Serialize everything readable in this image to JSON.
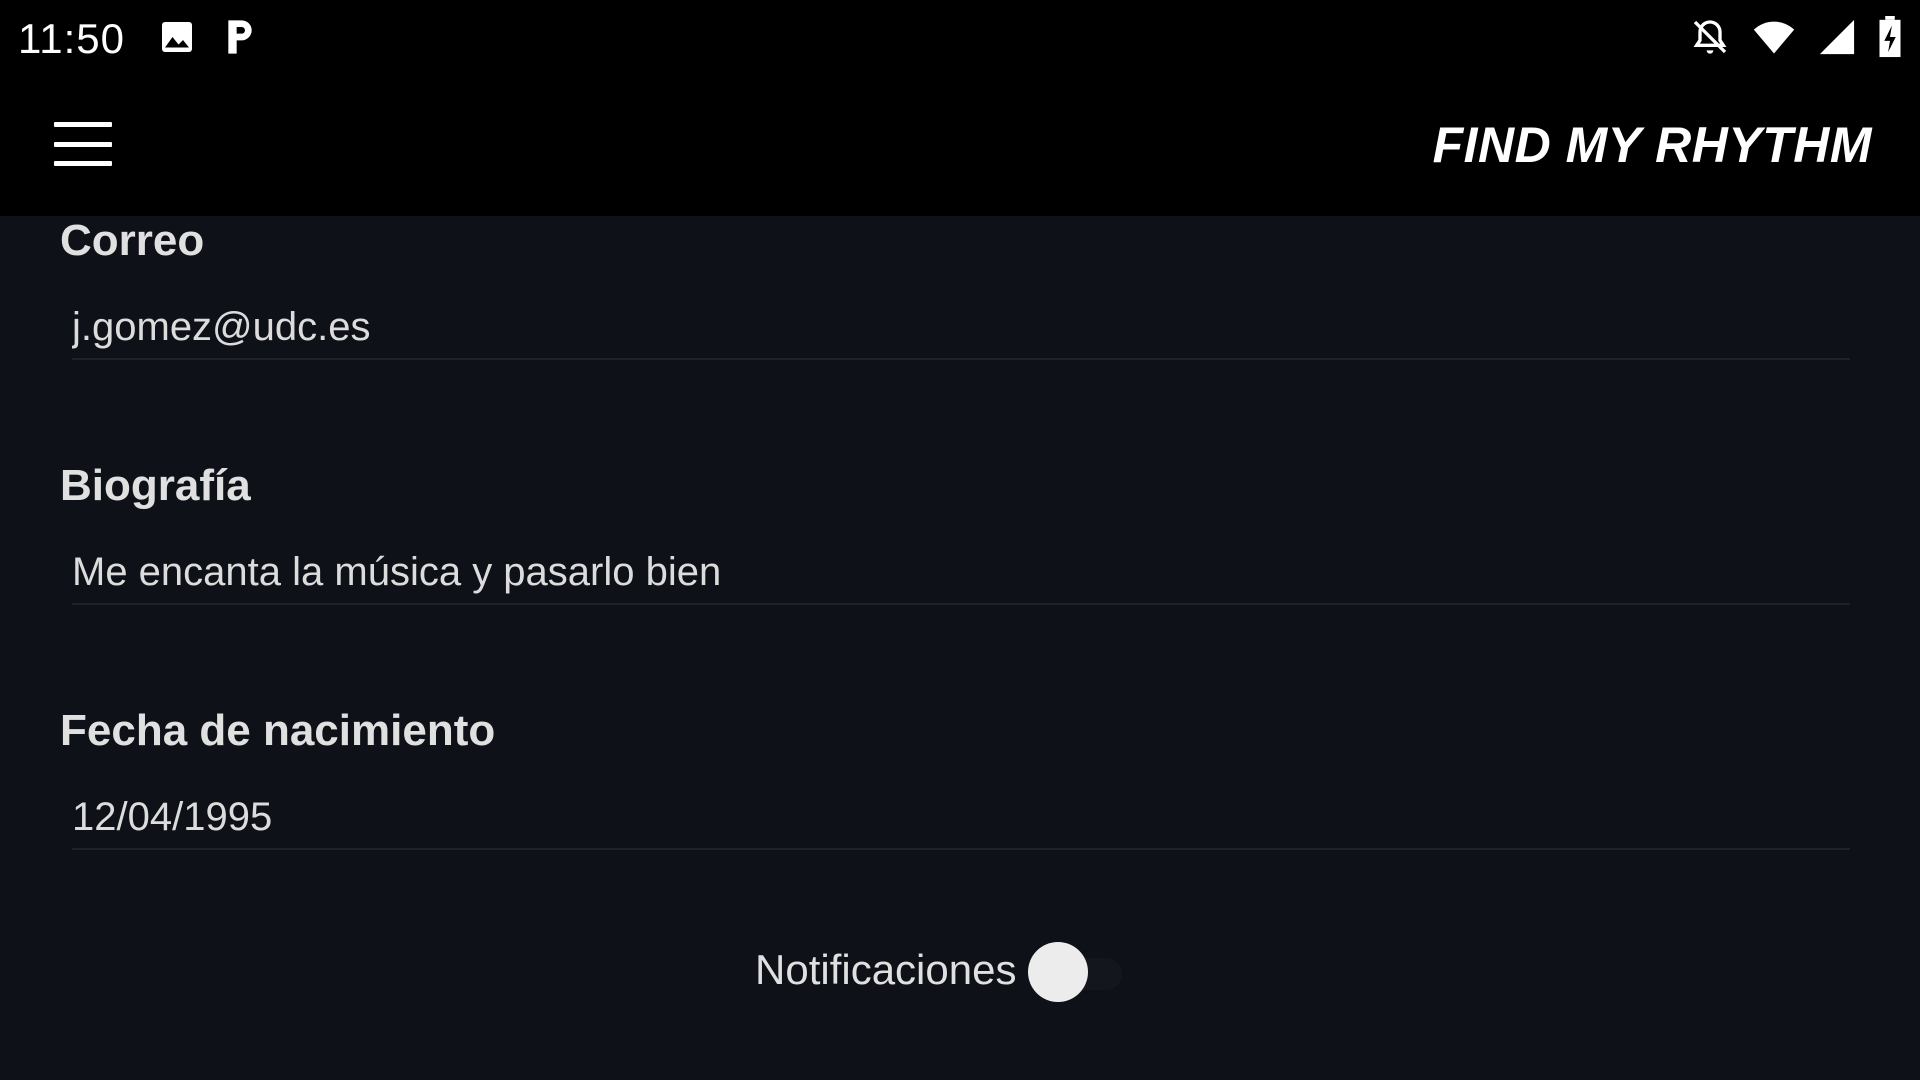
{
  "status_bar": {
    "time": "11:50",
    "left_icons": [
      "gallery-icon",
      "parking-p-icon"
    ],
    "right_icons": [
      "notifications-off-icon",
      "wifi-icon",
      "cell-signal-icon",
      "battery-charging-icon"
    ]
  },
  "app_bar": {
    "title": "FIND MY RHYTHM",
    "menu_icon": "hamburger-menu-icon"
  },
  "form": {
    "email": {
      "label": "Correo",
      "value": "j.gomez@udc.es"
    },
    "bio": {
      "label": "Biografía",
      "value": "Me encanta la música y pasarlo bien"
    },
    "birthdate": {
      "label": "Fecha de nacimiento",
      "value": "12/04/1995"
    },
    "notifications": {
      "label": "Notificaciones",
      "enabled": false
    }
  },
  "colors": {
    "background": "#0f1118",
    "bar": "#000000",
    "text": "#e6e6e6"
  }
}
